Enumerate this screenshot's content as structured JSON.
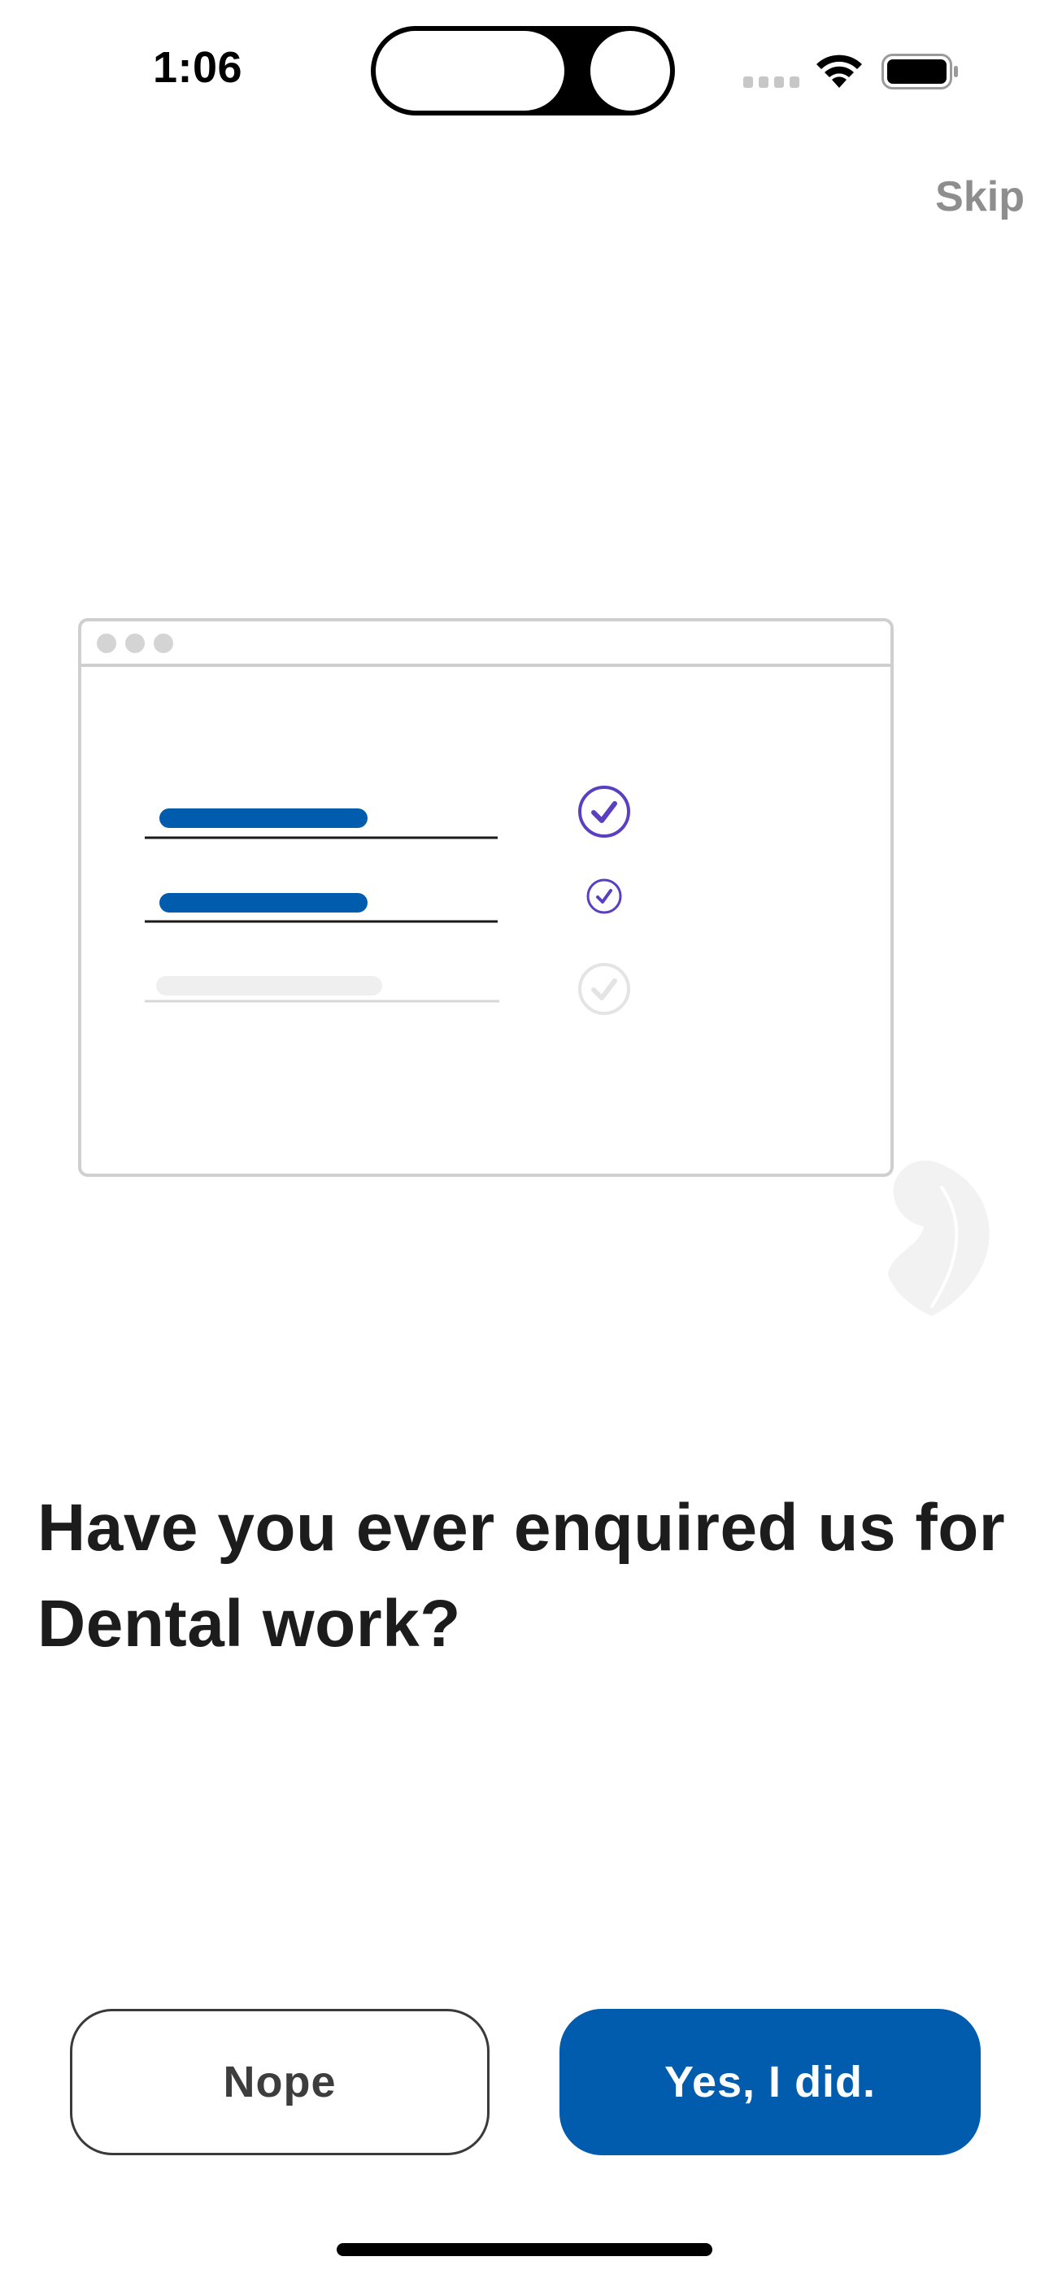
{
  "status_bar": {
    "time": "1:06",
    "icons": [
      "cellular-signal-icon",
      "wifi-icon",
      "battery-icon"
    ]
  },
  "header": {
    "skip_label": "Skip"
  },
  "illustration": {
    "icon": "form-checklist-illustration",
    "rows": [
      {
        "filled": true,
        "checked": true
      },
      {
        "filled": true,
        "checked": true
      },
      {
        "filled": false,
        "checked": false
      }
    ]
  },
  "main": {
    "question": "Have you ever enquired us for Dental work?"
  },
  "actions": {
    "nope_label": "Nope",
    "yes_label": "Yes, I did."
  },
  "colors": {
    "primary": "#015cad",
    "check_accent": "#5b3fc1",
    "muted_text": "#8e8e8e"
  }
}
